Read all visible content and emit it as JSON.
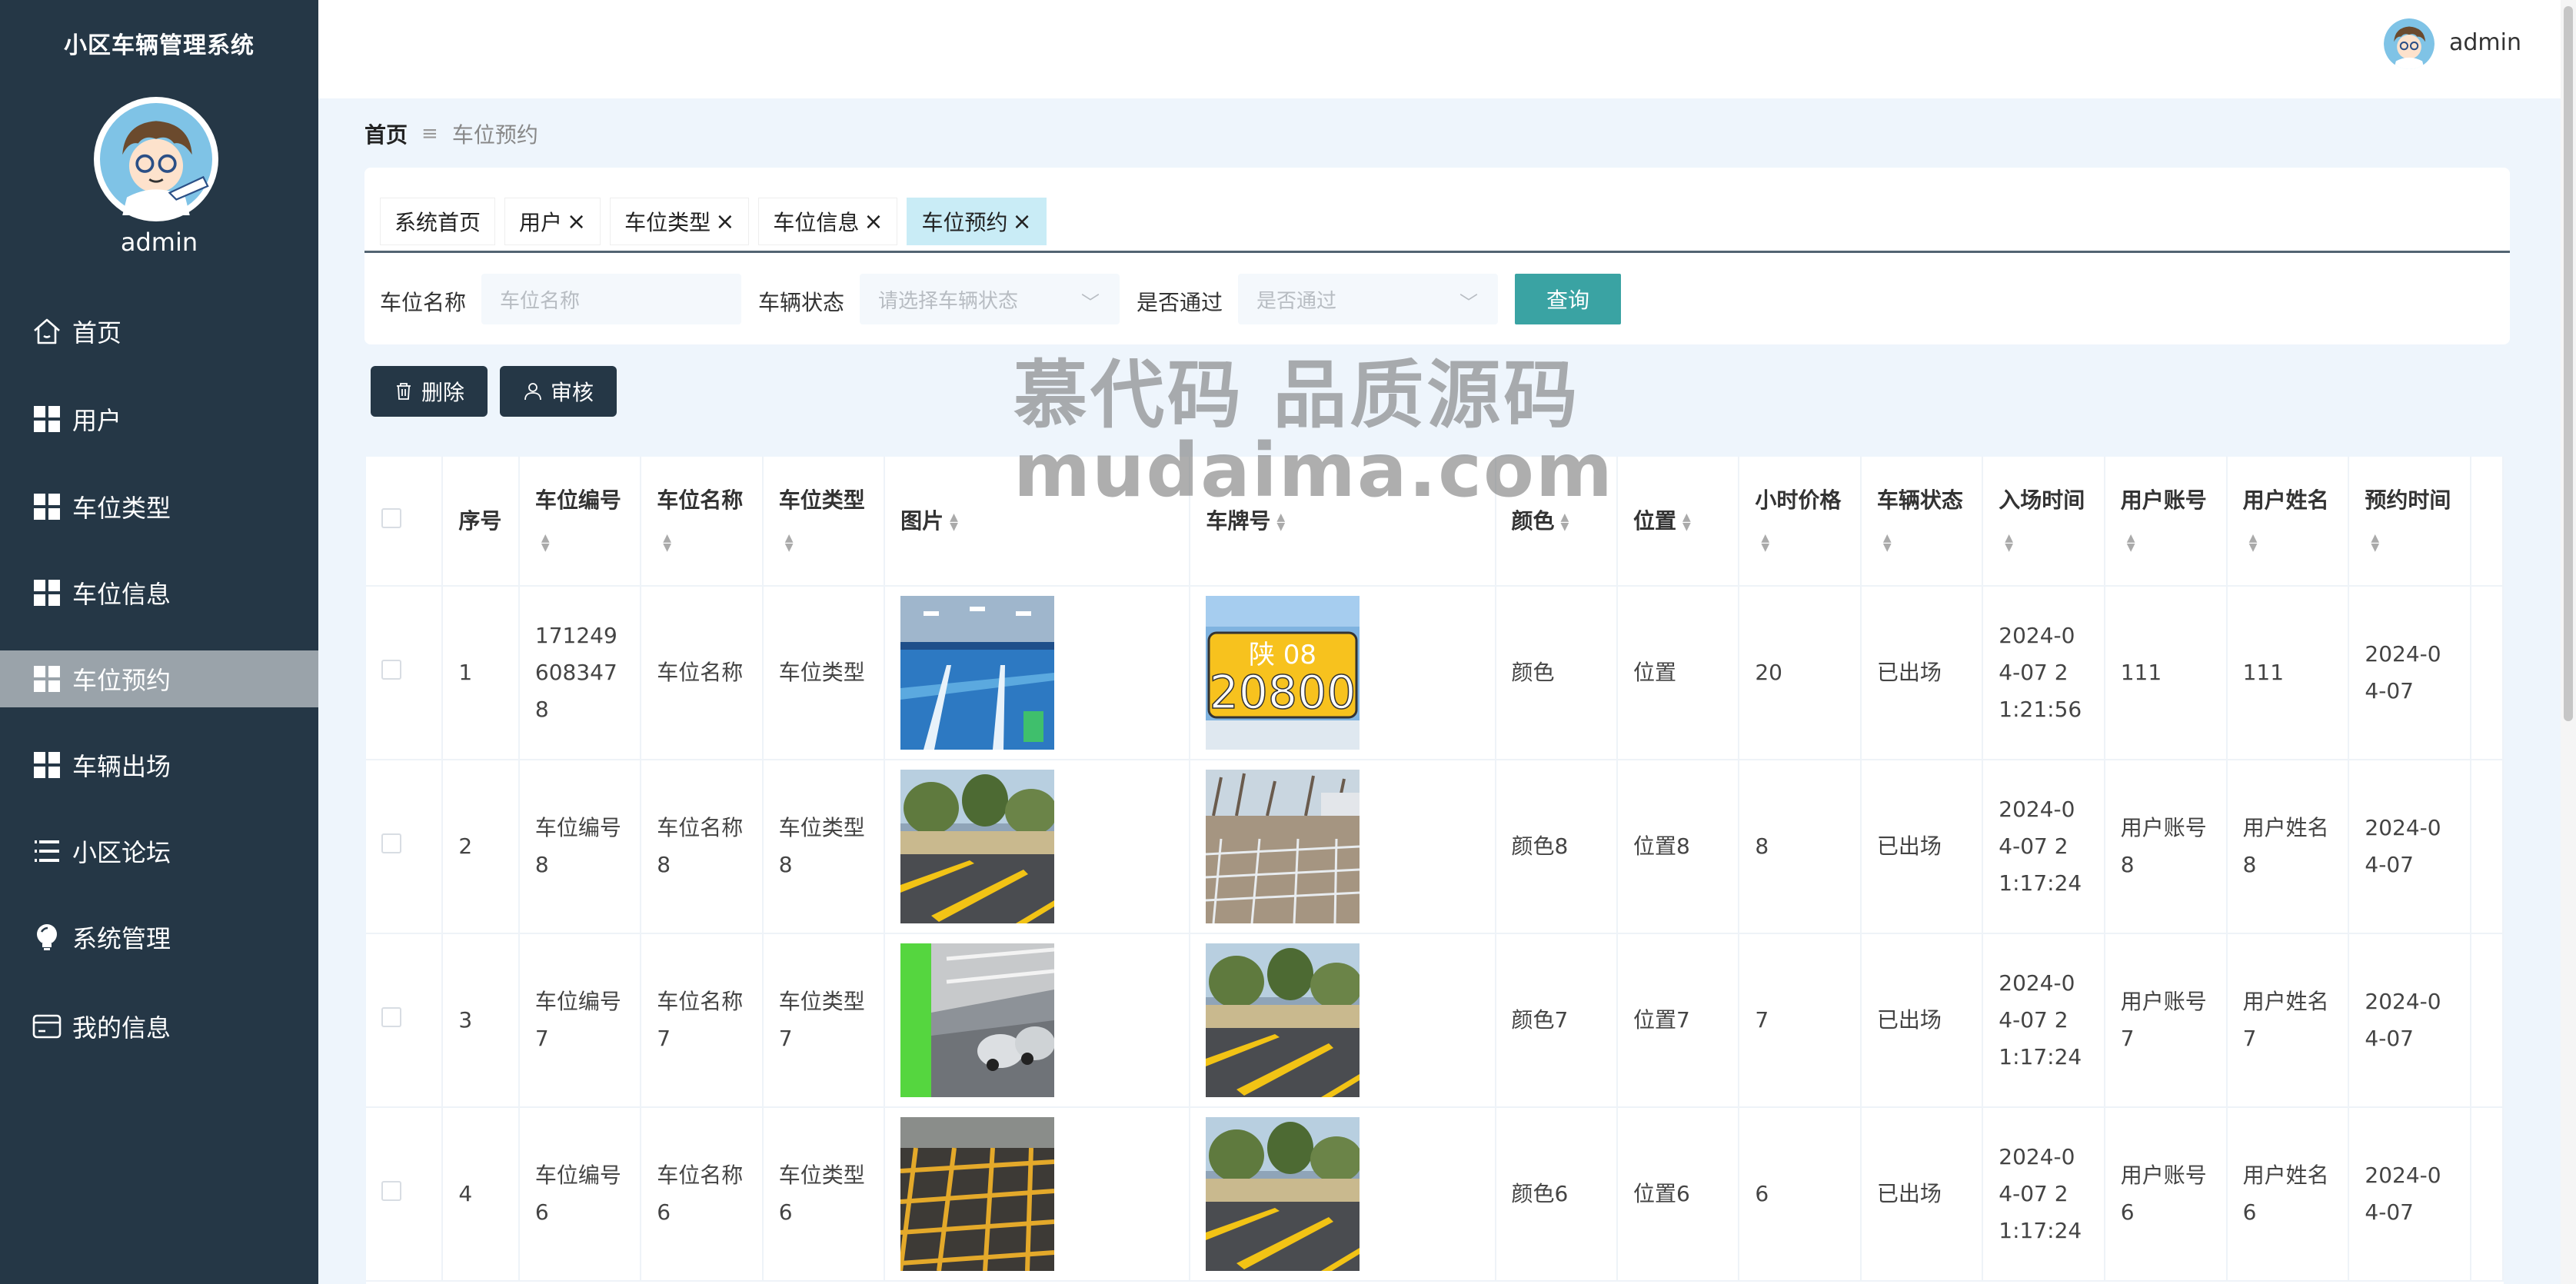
{
  "app": {
    "title": "小区车辆管理系统",
    "user": "admin"
  },
  "sidebar": {
    "items": [
      {
        "label": "首页",
        "icon": "home-icon"
      },
      {
        "label": "用户",
        "icon": "grid-icon"
      },
      {
        "label": "车位类型",
        "icon": "grid-icon"
      },
      {
        "label": "车位信息",
        "icon": "grid-icon"
      },
      {
        "label": "车位预约",
        "icon": "grid-icon",
        "active": true
      },
      {
        "label": "车辆出场",
        "icon": "grid-icon"
      },
      {
        "label": "小区论坛",
        "icon": "list-icon"
      },
      {
        "label": "系统管理",
        "icon": "bulb-icon"
      },
      {
        "label": "我的信息",
        "icon": "card-icon"
      }
    ]
  },
  "breadcrumb": {
    "home": "首页",
    "separator": "≡",
    "current": "车位预约"
  },
  "tabs": [
    {
      "label": "系统首页",
      "closable": false
    },
    {
      "label": "用户",
      "closable": true
    },
    {
      "label": "车位类型",
      "closable": true
    },
    {
      "label": "车位信息",
      "closable": true
    },
    {
      "label": "车位预约",
      "closable": true,
      "active": true
    }
  ],
  "tab_close_glyph": "×",
  "search": {
    "name_label": "车位名称",
    "name_placeholder": "车位名称",
    "status_label": "车辆状态",
    "status_placeholder": "请选择车辆状态",
    "pass_label": "是否通过",
    "pass_placeholder": "是否通过",
    "query_label": "查询"
  },
  "actions": {
    "delete_label": "删除",
    "audit_label": "审核"
  },
  "watermark": {
    "line1": "慕代码 品质源码",
    "line2": "mudaima.com"
  },
  "table": {
    "headers": [
      "序号",
      "车位编号",
      "车位名称",
      "车位类型",
      "图片",
      "车牌号",
      "颜色",
      "位置",
      "小时价格",
      "车辆状态",
      "入场时间",
      "用户账号",
      "用户姓名",
      "预约时间"
    ],
    "rows": [
      {
        "index": "1",
        "code": "1712496083478",
        "name": "车位名称",
        "type": "车位类型",
        "image": "garage-blue",
        "plate": "plate-yellow",
        "color": "颜色",
        "location": "位置",
        "price": "20",
        "status": "已出场",
        "entry_time": "2024-04-07 21:21:56",
        "account": "111",
        "username": "111",
        "booking_time": "2024-04-07"
      },
      {
        "index": "2",
        "code": "车位编号8",
        "name": "车位名称8",
        "type": "车位类型8",
        "image": "outdoor-yellow",
        "plate": "outdoor-grass",
        "color": "颜色8",
        "location": "位置8",
        "price": "8",
        "status": "已出场",
        "entry_time": "2024-04-07 21:17:24",
        "account": "用户账号8",
        "username": "用户姓名8",
        "booking_time": "2024-04-07"
      },
      {
        "index": "3",
        "code": "车位编号7",
        "name": "车位名称7",
        "type": "车位类型7",
        "image": "garage-grey",
        "plate": "outdoor-yellow",
        "color": "颜色7",
        "location": "位置7",
        "price": "7",
        "status": "已出场",
        "entry_time": "2024-04-07 21:17:24",
        "account": "用户账号7",
        "username": "用户姓名7",
        "booking_time": "2024-04-07"
      },
      {
        "index": "4",
        "code": "车位编号6",
        "name": "车位名称6",
        "type": "车位类型6",
        "image": "grid-yellow",
        "plate": "outdoor-yellow",
        "color": "颜色6",
        "location": "位置6",
        "price": "6",
        "status": "已出场",
        "entry_time": "2024-04-07 21:17:24",
        "account": "用户账号6",
        "username": "用户姓名6",
        "booking_time": "2024-04-07"
      }
    ]
  },
  "plate_text": {
    "top": "陕 08",
    "bottom": "20800"
  }
}
